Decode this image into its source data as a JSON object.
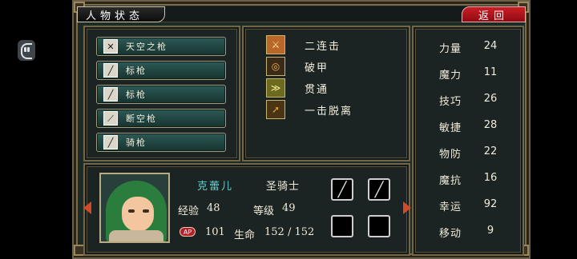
{
  "header": {
    "title": "人物状态",
    "back_label": "返回"
  },
  "weapons": [
    {
      "label": "天空之枪",
      "icon": "spear-icon"
    },
    {
      "label": "标枪",
      "icon": "javelin-icon"
    },
    {
      "label": "标枪",
      "icon": "javelin-icon"
    },
    {
      "label": "断空枪",
      "icon": "axe-spear-icon"
    },
    {
      "label": "骑枪",
      "icon": "lance-icon"
    }
  ],
  "skills": [
    {
      "label": "二连击",
      "icon": "double-strike-icon"
    },
    {
      "label": "破甲",
      "icon": "armor-break-icon"
    },
    {
      "label": "贯通",
      "icon": "pierce-icon"
    },
    {
      "label": "一击脱离",
      "icon": "hit-and-run-icon"
    }
  ],
  "character": {
    "name": "克蕾儿",
    "class": "圣骑士",
    "exp_label": "经验",
    "exp": "48",
    "level_label": "等级",
    "level": "49",
    "ap_badge": "AP",
    "ap": "101",
    "hp_label": "生命",
    "hp": "152 / 152"
  },
  "stats": [
    {
      "label": "力量",
      "value": "24"
    },
    {
      "label": "魔力",
      "value": "11"
    },
    {
      "label": "技巧",
      "value": "26"
    },
    {
      "label": "敏捷",
      "value": "28"
    },
    {
      "label": "物防",
      "value": "22"
    },
    {
      "label": "魔抗",
      "value": "16"
    },
    {
      "label": "幸运",
      "value": "92"
    },
    {
      "label": "移动",
      "value": "9"
    }
  ],
  "colors": {
    "panel_bg": "#1b2422",
    "border_gold": "#726649",
    "weapon_button": "#2d5a56",
    "back_button": "#cc1e26",
    "name_color": "#5fd0d4",
    "arrow": "#d24a2c"
  }
}
